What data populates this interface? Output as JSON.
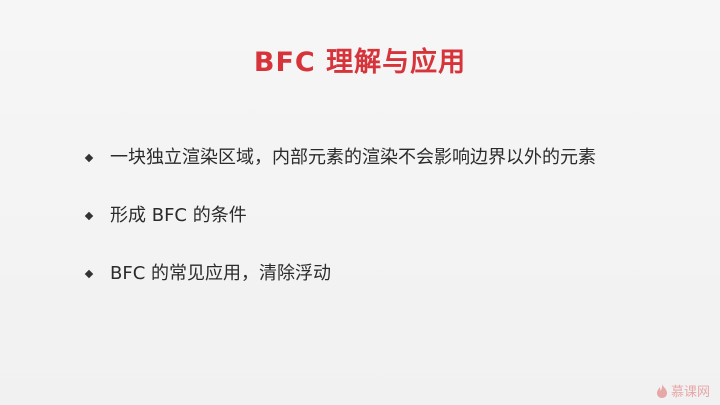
{
  "slide": {
    "title": "BFC 理解与应用",
    "bullets": [
      "一块独立渲染区域，内部元素的渲染不会影响边界以外的元素",
      "形成 BFC 的条件",
      "BFC 的常见应用，清除浮动"
    ],
    "title_color": "#d6343a",
    "text_color": "#2b2b2b"
  },
  "watermark": {
    "brand": "慕课网",
    "icon": "flame-logo-icon"
  }
}
